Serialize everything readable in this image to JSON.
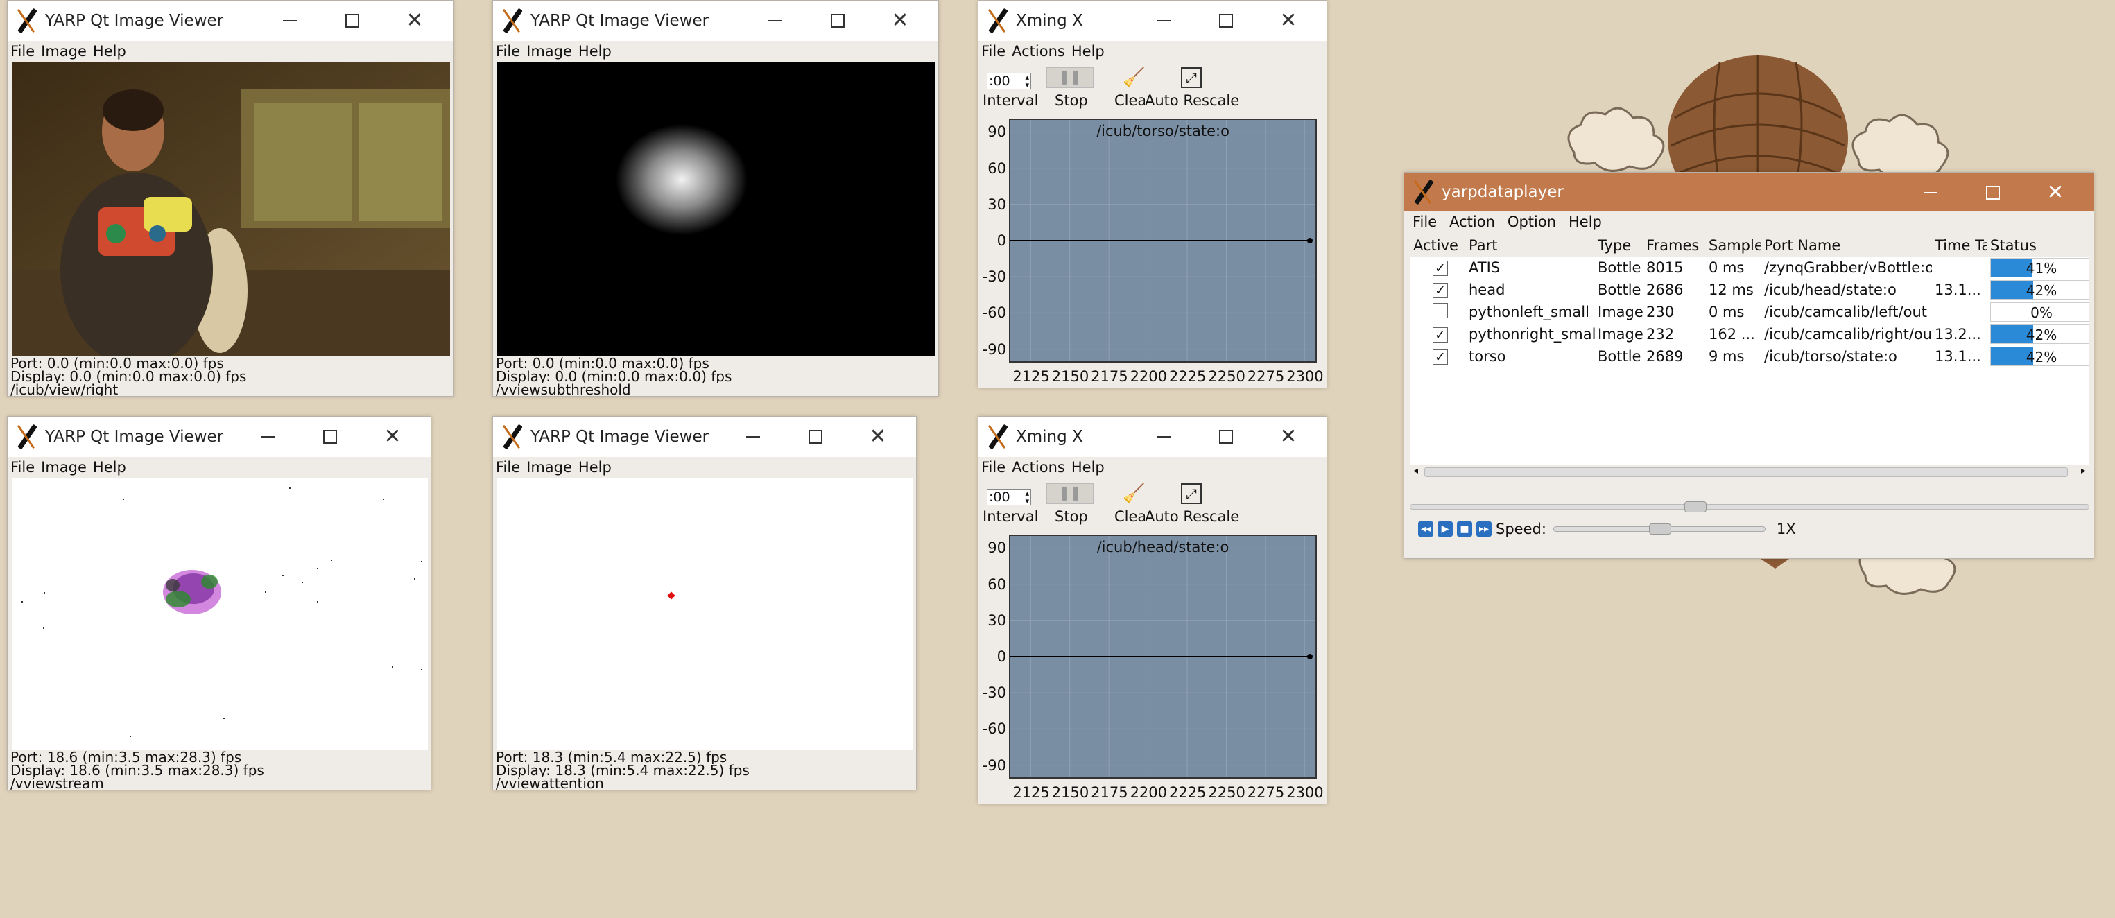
{
  "menus": {
    "viewer": [
      "File",
      "Image",
      "Help"
    ],
    "xming": [
      "File",
      "Actions",
      "Help"
    ],
    "ydp": [
      "File",
      "Action",
      "Option",
      "Help"
    ]
  },
  "viewer_title": "YARP Qt Image Viewer",
  "viewers": [
    {
      "port": "Port: 0.0 (min:0.0 max:0.0) fps",
      "display": "Display: 0.0 (min:0.0 max:0.0) fps",
      "name": "/icub/view/right"
    },
    {
      "port": "Port: 0.0 (min:0.0 max:0.0) fps",
      "display": "Display: 0.0 (min:0.0 max:0.0) fps",
      "name": "/vviewsubthreshold"
    },
    {
      "port": "Port: 18.6 (min:3.5 max:28.3) fps",
      "display": "Display: 18.6 (min:3.5 max:28.3) fps",
      "name": "/vviewstream"
    },
    {
      "port": "Port: 18.3 (min:5.4 max:22.5) fps",
      "display": "Display: 18.3 (min:5.4 max:22.5) fps",
      "name": "/vviewattention"
    }
  ],
  "xming": {
    "title": "Xming X",
    "interval_value": ":00",
    "toolbar": {
      "interval": "Interval",
      "stop": "Stop",
      "clear": "Clear",
      "auto_rescale": "Auto Rescale"
    },
    "plots": [
      {
        "title": "/icub/torso/state:o"
      },
      {
        "title": "/icub/head/state:o"
      }
    ],
    "yticks": [
      "90",
      "60",
      "30",
      "0",
      "-30",
      "-60",
      "-90"
    ],
    "xticks": [
      "2125",
      "2150",
      "2175",
      "2200",
      "2225",
      "2250",
      "2275",
      "2300"
    ],
    "ylim": [
      -100,
      100
    ],
    "xlim": [
      2112,
      2307
    ],
    "series_value": 0
  },
  "ydp": {
    "title": "yarpdataplayer",
    "headers": [
      "Active",
      "Part",
      "Type",
      "Frames",
      "Sample",
      "Port Name",
      "Time Ta",
      "Status"
    ],
    "rows": [
      {
        "active": true,
        "part": "ATIS",
        "type": "Bottle",
        "frames": "8015",
        "sample": "0 ms",
        "port": "/zynqGrabber/vBottle:o",
        "time": "",
        "status": "41%",
        "progress": 0.41
      },
      {
        "active": true,
        "part": "head",
        "type": "Bottle",
        "frames": "2686",
        "sample": "12 ms",
        "port": "/icub/head/state:o",
        "time": "13.1...",
        "status": "42%",
        "progress": 0.42
      },
      {
        "active": false,
        "part": "pythonleft_small",
        "type": "Image",
        "frames": "230",
        "sample": "0 ms",
        "port": "/icub/camcalib/left/out",
        "time": "",
        "status": "0%",
        "progress": 0
      },
      {
        "active": true,
        "part": "pythonright_small",
        "type": "Image",
        "frames": "232",
        "sample": "162 ...",
        "port": "/icub/camcalib/right/out",
        "time": "13.2...",
        "status": "42%",
        "progress": 0.42
      },
      {
        "active": true,
        "part": "torso",
        "type": "Bottle",
        "frames": "2689",
        "sample": "9 ms",
        "port": "/icub/torso/state:o",
        "time": "13.1...",
        "status": "42%",
        "progress": 0.42
      }
    ],
    "speed_label": "Speed:",
    "speed_value": "1X",
    "speed_level": 0.5,
    "check_mark": "✓"
  },
  "colors": {
    "progress": "#2b8ad8",
    "ydp_title": "#c27a4c",
    "plot_bg": "#7a8ea3"
  }
}
